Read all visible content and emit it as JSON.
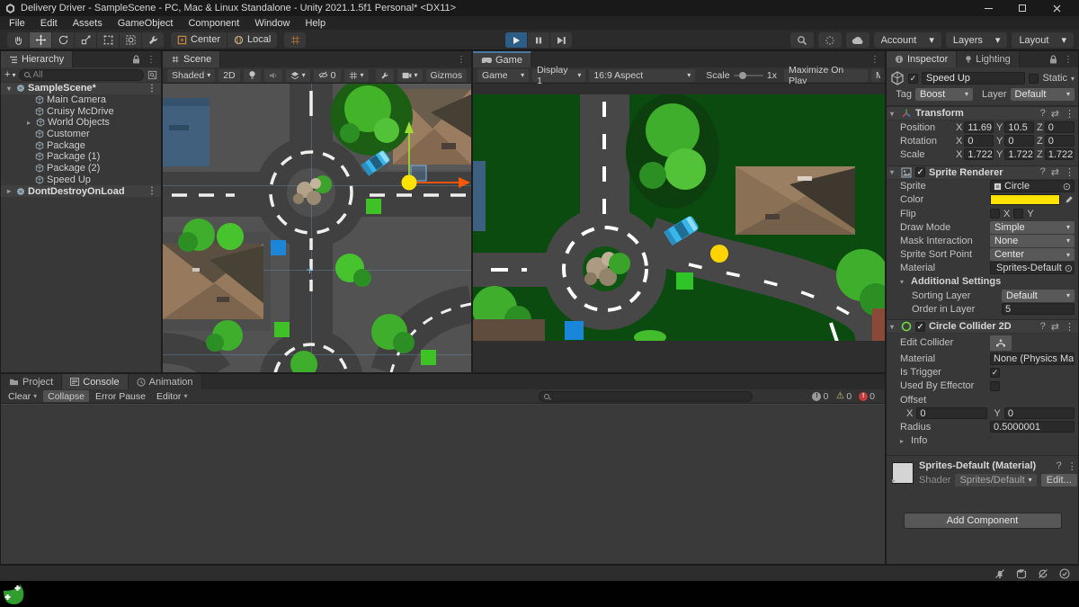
{
  "icons": {
    "dropdown": "▾",
    "expand": "▸",
    "kebab": "⋮",
    "check": "✓",
    "object_picker": "⊙",
    "help": "?",
    "plus": "+",
    "preset": "⇄"
  },
  "window": {
    "title": "Delivery Driver - SampleScene - PC, Mac & Linux Standalone - Unity 2021.1.5f1 Personal* <DX11>"
  },
  "menu": [
    "File",
    "Edit",
    "Assets",
    "GameObject",
    "Component",
    "Window",
    "Help"
  ],
  "toolbar": {
    "pivot": "Center",
    "space": "Local",
    "account": "Account",
    "layers": "Layers",
    "layout": "Layout"
  },
  "hierarchy": {
    "tab": "Hierarchy",
    "search_text": "All",
    "items": [
      {
        "label": "SampleScene*"
      },
      {
        "label": "Main Camera"
      },
      {
        "label": "Cruisy McDrive"
      },
      {
        "label": "World Objects"
      },
      {
        "label": "Customer"
      },
      {
        "label": "Package"
      },
      {
        "label": "Package (1)"
      },
      {
        "label": "Package (2)"
      },
      {
        "label": "Speed Up"
      },
      {
        "label": "DontDestroyOnLoad"
      }
    ]
  },
  "scene_view": {
    "tab": "Scene",
    "shading": "Shaded",
    "btn_2d": "2D",
    "hidden_count": "0",
    "gizmos": "Gizmos"
  },
  "game_view": {
    "tab": "Game",
    "mode": "Game",
    "display": "Display 1",
    "aspect": "16:9 Aspect",
    "scale_label": "Scale",
    "scale_value": "1x",
    "maximize_on_play": "Maximize On Play",
    "mute_clipped": "M"
  },
  "labels": {
    "x": "X",
    "y": "Y",
    "z": "Z",
    "tag": "Tag",
    "layer": "Layer",
    "static": "Static",
    "shader": "Shader"
  },
  "inspector": {
    "tab": "Inspector",
    "tab2": "Lighting",
    "game_object": {
      "name": "Speed Up",
      "tag": "Boost",
      "layer": "Default"
    },
    "transform": {
      "title": "Transform",
      "position_label": "Position",
      "rotation_label": "Rotation",
      "scale_label": "Scale",
      "position": {
        "x": "11.69",
        "y": "10.5",
        "z": "0"
      },
      "rotation": {
        "x": "0",
        "y": "0",
        "z": "0"
      },
      "scale": {
        "x": "1.722",
        "y": "1.722",
        "z": "1.722"
      }
    },
    "sprite_renderer": {
      "title": "Sprite Renderer",
      "sprite_label": "Sprite",
      "sprite": "Circle",
      "color_label": "Color",
      "color": "#FFE300",
      "flip_label": "Flip",
      "draw_mode_label": "Draw Mode",
      "draw_mode": "Simple",
      "mask_label": "Mask Interaction",
      "mask": "None",
      "sort_point_label": "Sprite Sort Point",
      "sort_point": "Center",
      "material_label": "Material",
      "material": "Sprites-Default",
      "additional_label": "Additional Settings",
      "sorting_layer_label": "Sorting Layer",
      "sorting_layer": "Default",
      "order_label": "Order in Layer",
      "order": "5"
    },
    "circle_collider": {
      "title": "Circle Collider 2D",
      "edit_label": "Edit Collider",
      "material_label": "Material",
      "material": "None (Physics Mat",
      "is_trigger_label": "Is Trigger",
      "effector_label": "Used By Effector",
      "offset_label": "Offset",
      "offset_x": "0",
      "offset_y": "0",
      "radius_label": "Radius",
      "radius": "0.5000001",
      "info_label": "Info"
    },
    "material_block": {
      "title": "Sprites-Default (Material)",
      "shader": "Sprites/Default",
      "edit_button": "Edit..."
    },
    "add_component": "Add Component"
  },
  "console": {
    "tabs": [
      "Project",
      "Console",
      "Animation"
    ],
    "clear": "Clear",
    "collapse": "Collapse",
    "error_pause": "Error Pause",
    "editor": "Editor",
    "info_count": "0",
    "warn_count": "0",
    "error_count": "0"
  },
  "colors": {
    "accent_play_blue": "#2C5D87",
    "selection_yellow": "#FFE300",
    "package_green": "#35C224",
    "customer_blue": "#1A84D8",
    "car_cyan": "#38B6EA",
    "gizmo_green": "#9ADF30",
    "gizmo_red": "#FF5A00"
  }
}
